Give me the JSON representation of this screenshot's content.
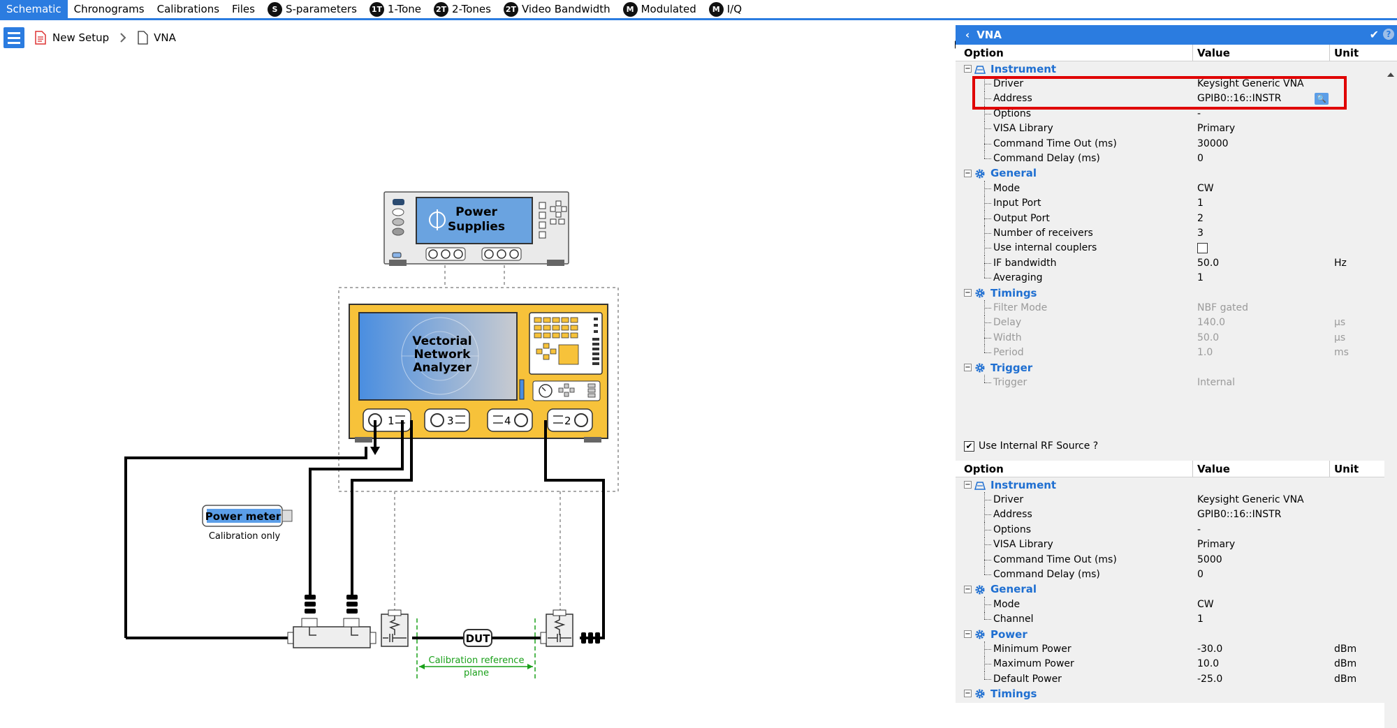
{
  "tabs": [
    {
      "label": "Schematic",
      "active": true,
      "badge": ""
    },
    {
      "label": "Chronograms",
      "badge": ""
    },
    {
      "label": "Calibrations",
      "badge": ""
    },
    {
      "label": "Files",
      "badge": ""
    },
    {
      "label": "S-parameters",
      "badge": "S"
    },
    {
      "label": "1-Tone",
      "badge": "1T"
    },
    {
      "label": "2-Tones",
      "badge": "2T"
    },
    {
      "label": "Video Bandwidth",
      "badge": "2T"
    },
    {
      "label": "Modulated",
      "badge": "M"
    },
    {
      "label": "I/Q",
      "badge": "M"
    }
  ],
  "breadcrumb": {
    "root": "New Setup",
    "current": "VNA"
  },
  "schematic": {
    "power_supplies": {
      "line1": "Power",
      "line2": "Supplies"
    },
    "vna": {
      "line1": "Vectorial",
      "line2": "Network",
      "line3": "Analyzer"
    },
    "ports": [
      "1",
      "3",
      "4",
      "2"
    ],
    "power_meter": {
      "label": "Power meter",
      "caption": "Calibration only"
    },
    "dut": "DUT",
    "cal_plane": {
      "line1": "Calibration reference",
      "line2": "plane"
    }
  },
  "panel": {
    "title": "VNA",
    "columns": {
      "option": "Option",
      "value": "Value",
      "unit": "Unit"
    },
    "rows1": [
      {
        "type": "group",
        "icon": "instrument",
        "label": "Instrument"
      },
      {
        "type": "leaf",
        "label": "Driver",
        "value": "Keysight Generic VNA",
        "unit": ""
      },
      {
        "type": "leaf",
        "label": "Address",
        "value": "GPIB0::16::INSTR",
        "unit": "",
        "search": true
      },
      {
        "type": "leaf",
        "label": "Options",
        "value": "-",
        "unit": ""
      },
      {
        "type": "leaf",
        "label": "VISA Library",
        "value": "Primary",
        "unit": ""
      },
      {
        "type": "leaf",
        "label": "Command Time Out (ms)",
        "value": "30000",
        "unit": ""
      },
      {
        "type": "leaf",
        "label": "Command Delay (ms)",
        "value": "0",
        "unit": "",
        "last": true
      },
      {
        "type": "group",
        "icon": "gear",
        "label": "General"
      },
      {
        "type": "leaf",
        "label": "Mode",
        "value": "CW",
        "unit": ""
      },
      {
        "type": "leaf",
        "label": "Input Port",
        "value": "1",
        "unit": ""
      },
      {
        "type": "leaf",
        "label": "Output Port",
        "value": "2",
        "unit": ""
      },
      {
        "type": "leaf",
        "label": "Number of receivers",
        "value": "3",
        "unit": ""
      },
      {
        "type": "leaf",
        "label": "Use internal couplers",
        "value": "",
        "unit": "",
        "checkbox": true
      },
      {
        "type": "leaf",
        "label": "IF bandwidth",
        "value": "50.0",
        "unit": "Hz"
      },
      {
        "type": "leaf",
        "label": "Averaging",
        "value": "1",
        "unit": "",
        "last": true
      },
      {
        "type": "group",
        "icon": "gear",
        "label": "Timings"
      },
      {
        "type": "leaf",
        "label": "Filter Mode",
        "value": "NBF gated",
        "unit": "",
        "disabled": true
      },
      {
        "type": "leaf",
        "label": "Delay",
        "value": "140.0",
        "unit": "µs",
        "disabled": true
      },
      {
        "type": "leaf",
        "label": "Width",
        "value": "50.0",
        "unit": "µs",
        "disabled": true
      },
      {
        "type": "leaf",
        "label": "Period",
        "value": "1.0",
        "unit": "ms",
        "disabled": true,
        "last": true
      },
      {
        "type": "group",
        "icon": "gear",
        "label": "Trigger"
      },
      {
        "type": "leaf",
        "label": "Trigger",
        "value": "Internal",
        "unit": "",
        "disabled": true,
        "last": true
      }
    ],
    "rf_source_label": "Use Internal RF Source ?",
    "rows2": [
      {
        "type": "group",
        "icon": "instrument",
        "label": "Instrument"
      },
      {
        "type": "leaf",
        "label": "Driver",
        "value": "Keysight Generic VNA",
        "unit": ""
      },
      {
        "type": "leaf",
        "label": "Address",
        "value": "GPIB0::16::INSTR",
        "unit": ""
      },
      {
        "type": "leaf",
        "label": "Options",
        "value": "-",
        "unit": ""
      },
      {
        "type": "leaf",
        "label": "VISA Library",
        "value": "Primary",
        "unit": ""
      },
      {
        "type": "leaf",
        "label": "Command Time Out (ms)",
        "value": "5000",
        "unit": ""
      },
      {
        "type": "leaf",
        "label": "Command Delay (ms)",
        "value": "0",
        "unit": "",
        "last": true
      },
      {
        "type": "group",
        "icon": "gear",
        "label": "General"
      },
      {
        "type": "leaf",
        "label": "Mode",
        "value": "CW",
        "unit": ""
      },
      {
        "type": "leaf",
        "label": "Channel",
        "value": "1",
        "unit": "",
        "last": true
      },
      {
        "type": "group",
        "icon": "gear",
        "label": "Power"
      },
      {
        "type": "leaf",
        "label": "Minimum Power",
        "value": "-30.0",
        "unit": "dBm"
      },
      {
        "type": "leaf",
        "label": "Maximum Power",
        "value": "10.0",
        "unit": "dBm"
      },
      {
        "type": "leaf",
        "label": "Default Power",
        "value": "-25.0",
        "unit": "dBm",
        "last": true
      },
      {
        "type": "group",
        "icon": "gear",
        "label": "Timings"
      }
    ]
  },
  "colors": {
    "accent": "#2b7ce0",
    "highlight": "#e00000",
    "vna_body": "#f7c23a",
    "cal_plane": "#1aa01a"
  }
}
